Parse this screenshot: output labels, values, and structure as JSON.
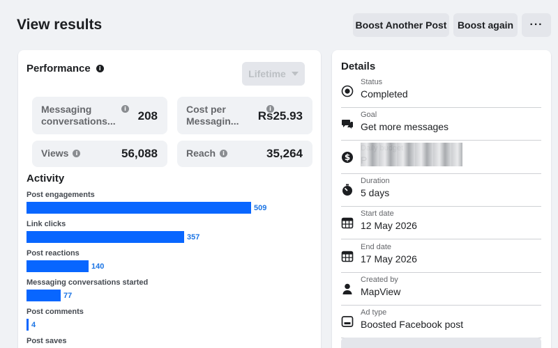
{
  "header": {
    "title": "View results",
    "boost_another": "Boost Another Post",
    "boost_again": "Boost again",
    "more": "···"
  },
  "performance": {
    "title": "Performance",
    "range": "Lifetime",
    "metrics": [
      {
        "label": "Messaging conversations...",
        "value": "208"
      },
      {
        "label": "Cost per Messagin...",
        "value": "Rs25.93"
      },
      {
        "label": "Views",
        "value": "56,088"
      },
      {
        "label": "Reach",
        "value": "35,264"
      }
    ]
  },
  "activity": {
    "title": "Activity",
    "max": 509,
    "rows": [
      {
        "label": "Post engagements",
        "value": 509
      },
      {
        "label": "Link clicks",
        "value": 357
      },
      {
        "label": "Post reactions",
        "value": 140
      },
      {
        "label": "Messaging conversations started",
        "value": 77
      },
      {
        "label": "Post comments",
        "value": 4
      },
      {
        "label": "Post saves",
        "value": null
      }
    ]
  },
  "details": {
    "title": "Details",
    "rows": [
      {
        "icon": "status-icon",
        "label": "Status",
        "value": "Completed"
      },
      {
        "icon": "messenger-icon",
        "label": "Goal",
        "value": "Get more messages"
      },
      {
        "icon": "dollar-icon",
        "label": "Daily budget",
        "value": "P"
      },
      {
        "icon": "stopwatch-icon",
        "label": "Duration",
        "value": "5 days"
      },
      {
        "icon": "calendar-icon",
        "label": "Start date",
        "value": "12 May 2026"
      },
      {
        "icon": "calendar-icon",
        "label": "End date",
        "value": "17 May 2026"
      },
      {
        "icon": "person-icon",
        "label": "Created by",
        "value": "MapView"
      },
      {
        "icon": "ad-icon",
        "label": "Ad type",
        "value": "Boosted Facebook post"
      }
    ]
  },
  "colors": {
    "accent": "#0866ff",
    "bar_label": "#1b74e4",
    "page_bg": "#f0f2f5"
  }
}
